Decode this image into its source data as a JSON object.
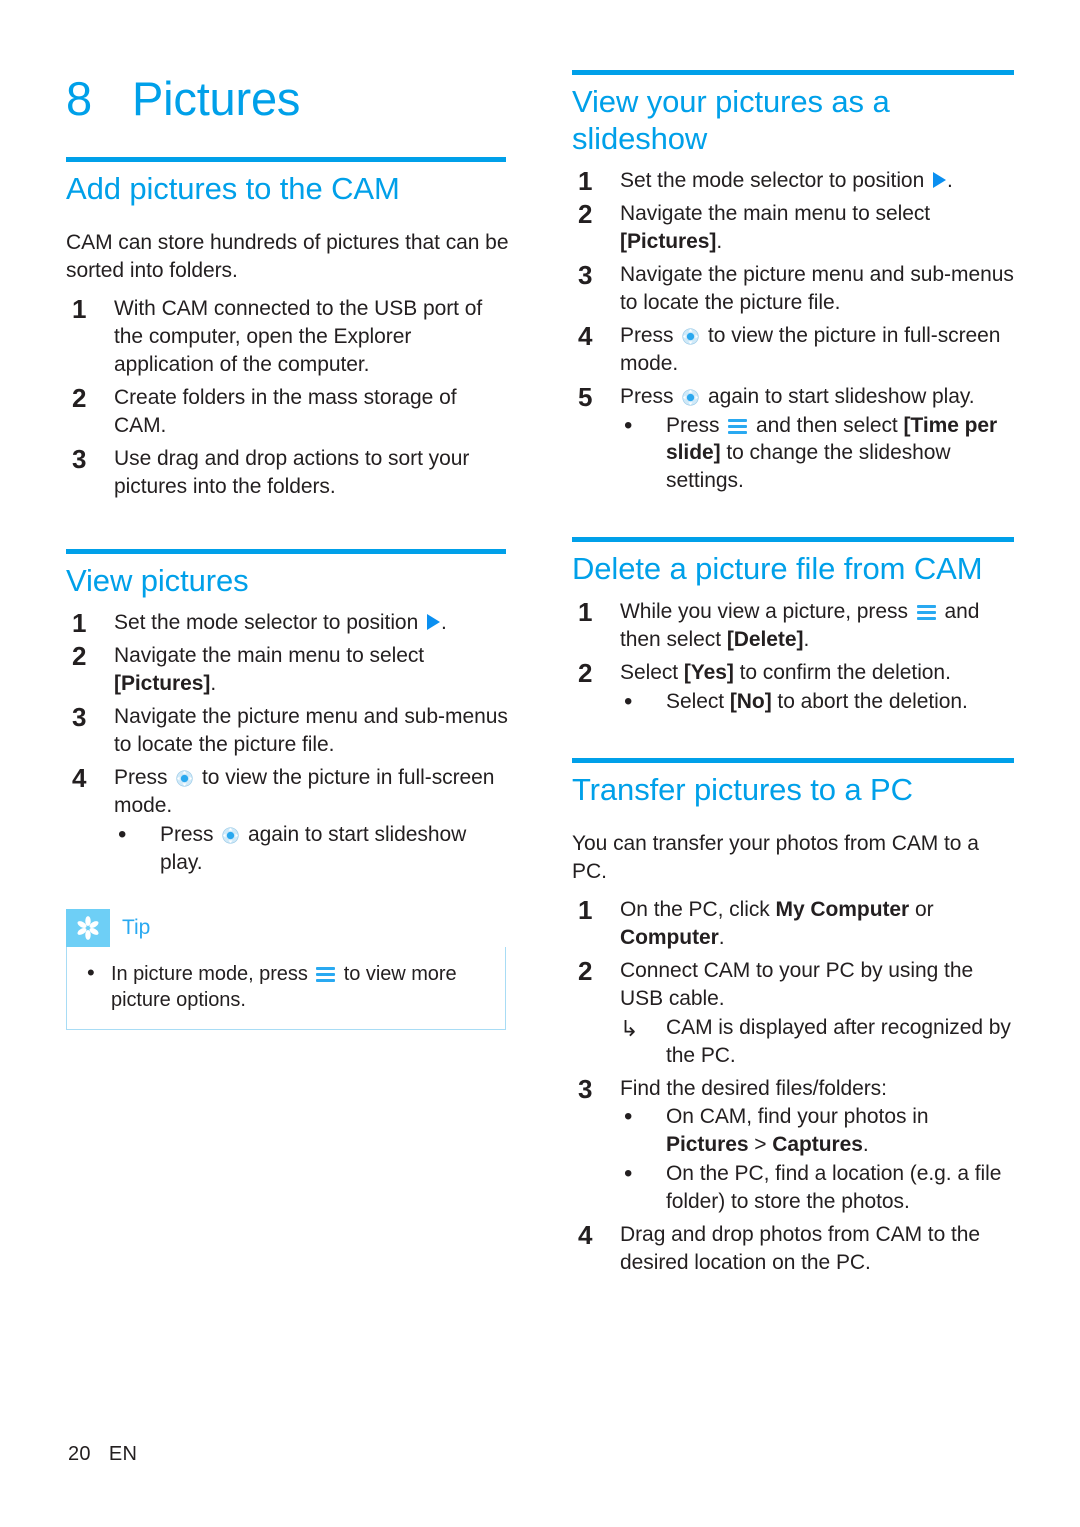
{
  "colors": {
    "accent": "#00a0e9",
    "icon_blue": "#29a9f1",
    "tip_badge": "#6ecff6",
    "tip_border": "#a8dcf5",
    "text": "#231f20"
  },
  "chapter": {
    "number": "8",
    "title": "Pictures"
  },
  "icons": {
    "mode_selector": "play-triangle-icon",
    "nav_pad": "navigation-pad-icon",
    "menu_key": "menu-hamburger-icon",
    "tip_badge": "asterisk-star-icon",
    "result_arrow": "↳"
  },
  "left_column": {
    "sections": [
      {
        "id": "add-pictures",
        "heading": "Add pictures to the CAM",
        "intro": "CAM can store hundreds of pictures that can be sorted into folders.",
        "steps": [
          {
            "num": "1",
            "parts": [
              {
                "t": "text",
                "v": "With CAM connected to the USB port of the computer, open the Explorer application of the computer."
              }
            ]
          },
          {
            "num": "2",
            "parts": [
              {
                "t": "text",
                "v": "Create folders in the mass storage of CAM."
              }
            ]
          },
          {
            "num": "3",
            "parts": [
              {
                "t": "text",
                "v": "Use drag and drop actions to sort your pictures into the folders."
              }
            ]
          }
        ]
      },
      {
        "id": "view-pictures",
        "heading": "View pictures",
        "steps": [
          {
            "num": "1",
            "parts": [
              {
                "t": "text",
                "v": "Set the mode selector to position "
              },
              {
                "t": "icon",
                "v": "play"
              },
              {
                "t": "text",
                "v": "."
              }
            ]
          },
          {
            "num": "2",
            "parts": [
              {
                "t": "text",
                "v": "Navigate the main menu to select "
              },
              {
                "t": "bold",
                "v": "[Pictures]"
              },
              {
                "t": "text",
                "v": "."
              }
            ]
          },
          {
            "num": "3",
            "parts": [
              {
                "t": "text",
                "v": "Navigate the picture menu and sub-menus to locate the picture file."
              }
            ]
          },
          {
            "num": "4",
            "parts": [
              {
                "t": "text",
                "v": "Press "
              },
              {
                "t": "icon",
                "v": "nav"
              },
              {
                "t": "text",
                "v": " to view the picture in full-screen mode."
              }
            ],
            "sub": [
              {
                "marker": "dot",
                "parts": [
                  {
                    "t": "text",
                    "v": "Press "
                  },
                  {
                    "t": "icon",
                    "v": "nav"
                  },
                  {
                    "t": "text",
                    "v": " again to start slideshow play."
                  }
                ]
              }
            ]
          }
        ],
        "tip": {
          "label": "Tip",
          "items": [
            {
              "marker": "dot",
              "parts": [
                {
                  "t": "text",
                  "v": "In picture mode, press "
                },
                {
                  "t": "icon",
                  "v": "menu"
                },
                {
                  "t": "text",
                  "v": " to view more picture options."
                }
              ]
            }
          ]
        }
      }
    ]
  },
  "right_column": {
    "sections": [
      {
        "id": "slideshow",
        "heading": "View your pictures as a slideshow",
        "steps": [
          {
            "num": "1",
            "parts": [
              {
                "t": "text",
                "v": "Set the mode selector to position "
              },
              {
                "t": "icon",
                "v": "play"
              },
              {
                "t": "text",
                "v": "."
              }
            ]
          },
          {
            "num": "2",
            "parts": [
              {
                "t": "text",
                "v": "Navigate the main menu to select "
              },
              {
                "t": "bold",
                "v": "[Pictures]"
              },
              {
                "t": "text",
                "v": "."
              }
            ]
          },
          {
            "num": "3",
            "parts": [
              {
                "t": "text",
                "v": "Navigate the picture menu and sub-menus to locate the picture file."
              }
            ]
          },
          {
            "num": "4",
            "parts": [
              {
                "t": "text",
                "v": "Press "
              },
              {
                "t": "icon",
                "v": "nav"
              },
              {
                "t": "text",
                "v": " to view the picture in full-screen mode."
              }
            ]
          },
          {
            "num": "5",
            "parts": [
              {
                "t": "text",
                "v": "Press "
              },
              {
                "t": "icon",
                "v": "nav"
              },
              {
                "t": "text",
                "v": " again to start slideshow play."
              }
            ],
            "sub": [
              {
                "marker": "dot",
                "parts": [
                  {
                    "t": "text",
                    "v": "Press "
                  },
                  {
                    "t": "icon",
                    "v": "menu"
                  },
                  {
                    "t": "text",
                    "v": " and then select "
                  },
                  {
                    "t": "bold",
                    "v": "[Time per slide]"
                  },
                  {
                    "t": "text",
                    "v": " to change the slideshow settings."
                  }
                ]
              }
            ]
          }
        ]
      },
      {
        "id": "delete-picture",
        "heading": "Delete a picture file from CAM",
        "steps": [
          {
            "num": "1",
            "parts": [
              {
                "t": "text",
                "v": "While you view a picture, press "
              },
              {
                "t": "icon",
                "v": "menu"
              },
              {
                "t": "text",
                "v": " and then select "
              },
              {
                "t": "bold",
                "v": "[Delete]"
              },
              {
                "t": "text",
                "v": "."
              }
            ]
          },
          {
            "num": "2",
            "parts": [
              {
                "t": "text",
                "v": "Select "
              },
              {
                "t": "bold",
                "v": "[Yes]"
              },
              {
                "t": "text",
                "v": " to confirm the deletion."
              }
            ],
            "sub": [
              {
                "marker": "dot",
                "parts": [
                  {
                    "t": "text",
                    "v": "Select "
                  },
                  {
                    "t": "bold",
                    "v": "[No]"
                  },
                  {
                    "t": "text",
                    "v": " to abort the deletion."
                  }
                ]
              }
            ]
          }
        ]
      },
      {
        "id": "transfer-pictures",
        "heading": "Transfer pictures to a PC",
        "intro": "You can transfer your photos from CAM to a PC.",
        "steps": [
          {
            "num": "1",
            "parts": [
              {
                "t": "text",
                "v": "On the PC, click "
              },
              {
                "t": "bold",
                "v": "My Computer"
              },
              {
                "t": "text",
                "v": " or "
              },
              {
                "t": "bold",
                "v": "Computer"
              },
              {
                "t": "text",
                "v": "."
              }
            ]
          },
          {
            "num": "2",
            "parts": [
              {
                "t": "text",
                "v": "Connect CAM to your PC by using the USB cable."
              }
            ],
            "sub": [
              {
                "marker": "arrow",
                "parts": [
                  {
                    "t": "text",
                    "v": "CAM is displayed after recognized by the PC."
                  }
                ]
              }
            ]
          },
          {
            "num": "3",
            "parts": [
              {
                "t": "text",
                "v": "Find the desired files/folders:"
              }
            ],
            "sub": [
              {
                "marker": "dot",
                "parts": [
                  {
                    "t": "text",
                    "v": "On CAM, find your photos in "
                  },
                  {
                    "t": "bold",
                    "v": "Pictures"
                  },
                  {
                    "t": "text",
                    "v": " > "
                  },
                  {
                    "t": "bold",
                    "v": "Captures"
                  },
                  {
                    "t": "text",
                    "v": "."
                  }
                ]
              },
              {
                "marker": "dot",
                "parts": [
                  {
                    "t": "text",
                    "v": "On the PC, find a location (e.g. a file folder) to store the photos."
                  }
                ]
              }
            ]
          },
          {
            "num": "4",
            "parts": [
              {
                "t": "text",
                "v": "Drag and drop photos from CAM to the desired location on the PC."
              }
            ]
          }
        ]
      }
    ]
  },
  "footer": {
    "page_number": "20",
    "language": "EN"
  }
}
